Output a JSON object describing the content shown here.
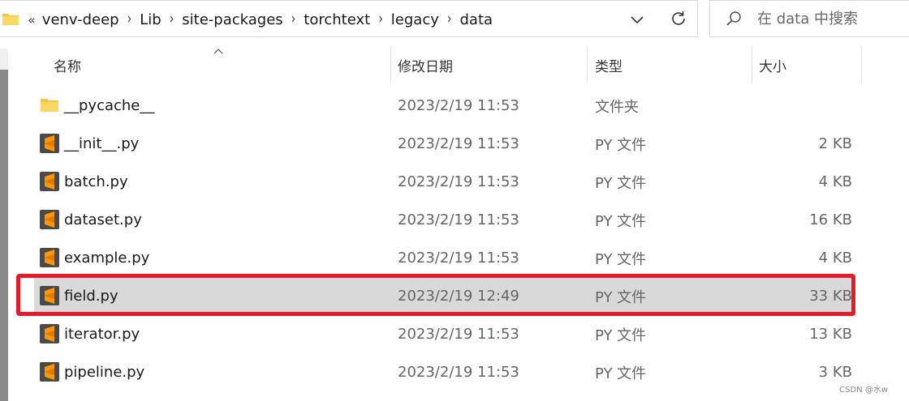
{
  "address_bar": {
    "overflow": "«",
    "crumbs": [
      "venv-deep",
      "Lib",
      "site-packages",
      "torchtext",
      "legacy",
      "data"
    ]
  },
  "search": {
    "placeholder": "在 data 中搜索"
  },
  "columns": {
    "name": "名称",
    "modified": "修改日期",
    "type": "类型",
    "size": "大小"
  },
  "files": [
    {
      "name": "__pycache__",
      "modified": "2023/2/19 11:53",
      "type": "文件夹",
      "size": "",
      "icon": "folder-icon"
    },
    {
      "name": "__init__.py",
      "modified": "2023/2/19 11:53",
      "type": "PY 文件",
      "size": "2 KB",
      "icon": "sublime-file-icon"
    },
    {
      "name": "batch.py",
      "modified": "2023/2/19 11:53",
      "type": "PY 文件",
      "size": "4 KB",
      "icon": "sublime-file-icon"
    },
    {
      "name": "dataset.py",
      "modified": "2023/2/19 11:53",
      "type": "PY 文件",
      "size": "16 KB",
      "icon": "sublime-file-icon"
    },
    {
      "name": "example.py",
      "modified": "2023/2/19 11:53",
      "type": "PY 文件",
      "size": "4 KB",
      "icon": "sublime-file-icon"
    },
    {
      "name": "field.py",
      "modified": "2023/2/19 12:49",
      "type": "PY 文件",
      "size": "33 KB",
      "icon": "sublime-file-icon",
      "selected": true
    },
    {
      "name": "iterator.py",
      "modified": "2023/2/19 11:53",
      "type": "PY 文件",
      "size": "13 KB",
      "icon": "sublime-file-icon"
    },
    {
      "name": "pipeline.py",
      "modified": "2023/2/19 11:53",
      "type": "PY 文件",
      "size": "3 KB",
      "icon": "sublime-file-icon"
    }
  ],
  "colors": {
    "highlight": "#e21c2b",
    "selected_row": "#d9d9d9",
    "folder": "#f5c24c",
    "py_icon": "#4a4a4a",
    "py_icon_accent": "#ff9800"
  },
  "watermark": "CSDN @水w"
}
